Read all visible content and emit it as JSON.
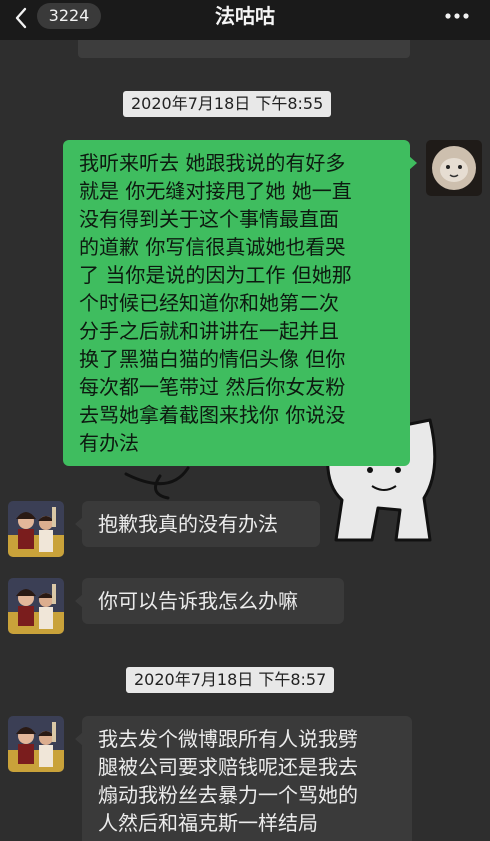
{
  "header": {
    "unread_count": "3224",
    "title": "法咕咕"
  },
  "messages": [
    {
      "type": "time",
      "text": "2020年7月18日 下午8:55"
    },
    {
      "type": "outgoing",
      "sender": "self",
      "text": "我听来听去 她跟我说的有好多\n就是 你无缝对接甩了她 她一直\n没有得到关于这个事情最直面\n的道歉 你写信很真诚她也看哭\n了 当你是说的因为工作 但她那\n个时候已经知道你和她第二次\n分手之后就和讲讲在一起并且\n换了黑猫白猫的情侣头像 但你\n每次都一笔带过 然后你女友粉\n去骂她拿着截图来找你 你说没\n有办法"
    },
    {
      "type": "incoming",
      "sender": "contact",
      "text": "抱歉我真的没有办法"
    },
    {
      "type": "incoming",
      "sender": "contact",
      "text": "你可以告诉我怎么办嘛"
    },
    {
      "type": "time",
      "text": "2020年7月18日 下午8:57"
    },
    {
      "type": "incoming",
      "sender": "contact",
      "text": "我去发个微博跟所有人说我劈\n腿被公司要求赔钱呢还是我去\n煽动我粉丝去暴力一个骂她的\n人然后和福克斯一样结局"
    }
  ],
  "icons": {
    "back": "chevron-left-icon",
    "more": "more-dots-icon"
  },
  "colors": {
    "outgoing_bubble": "#3fbd5f",
    "incoming_bubble": "#3a3a3a",
    "timestamp_bg": "#e8e8e8",
    "header_bg": "#1a1a1a"
  }
}
